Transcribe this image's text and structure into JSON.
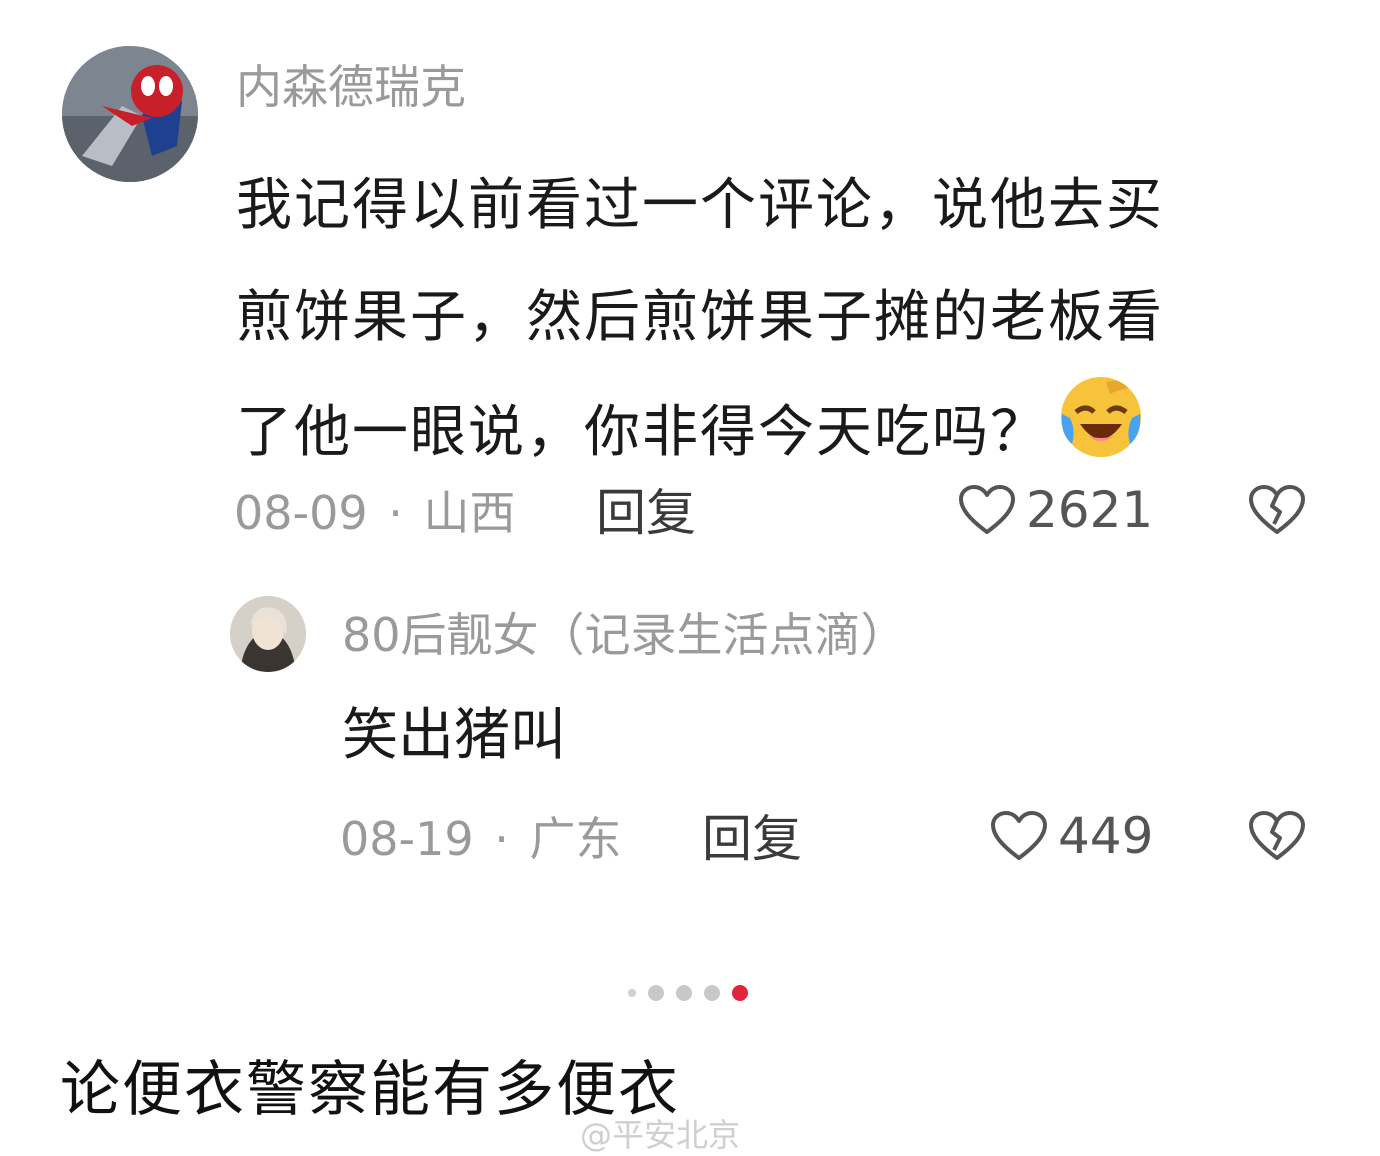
{
  "comment": {
    "username": "内森德瑞克",
    "lines": [
      "我记得以前看过一个评论，说他去买",
      "煎饼果子，然后煎饼果子摊的老板看",
      "了他一眼说，你非得今天吃吗？"
    ],
    "emoji": "laughing-crying-emoji",
    "date": "08-09",
    "separator": "·",
    "location": "山西",
    "reply_label": "回复",
    "likes": "2621"
  },
  "reply": {
    "username": "80后靓女（记录生活点滴）",
    "text": "笑出猪叫",
    "date": "08-19",
    "separator": "·",
    "location": "广东",
    "reply_label": "回复",
    "likes": "449"
  },
  "pager": {
    "total": 5,
    "active": 5
  },
  "caption": "论便衣警察能有多便衣",
  "watermark": "@平安北京",
  "colors": {
    "accent": "#e0243a",
    "meta": "#9a9a9a"
  }
}
